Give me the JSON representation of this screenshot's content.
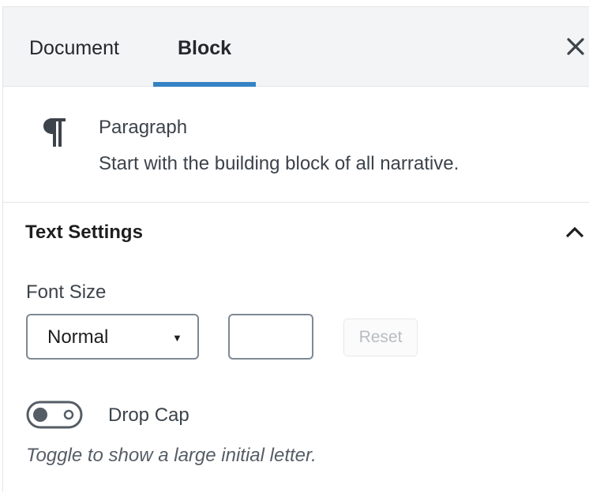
{
  "tabs": {
    "document_label": "Document",
    "block_label": "Block",
    "active": "Block"
  },
  "block_card": {
    "title": "Paragraph",
    "description": "Start with the building block of all narrative."
  },
  "text_settings": {
    "title": "Text Settings",
    "expanded": true,
    "font_size": {
      "label": "Font Size",
      "selected": "Normal",
      "custom_value": "",
      "reset_label": "Reset",
      "reset_disabled": true
    },
    "drop_cap": {
      "label": "Drop Cap",
      "enabled": false,
      "help": "Toggle to show a large initial letter."
    }
  },
  "colors": {
    "accent": "#3582c4",
    "tab_bar": "#f3f4f5",
    "border": "#e2e4e7",
    "control_border": "#7e8993",
    "toggle": "#555d66"
  },
  "icons": {
    "close": "close-icon",
    "block": "paragraph-icon",
    "collapse": "chevron-up-icon",
    "select": "caret-down-icon"
  }
}
